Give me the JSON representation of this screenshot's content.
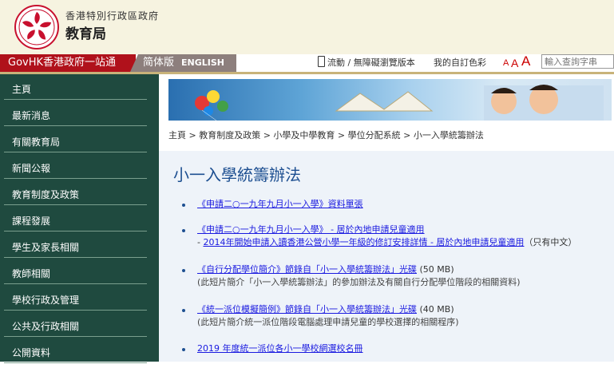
{
  "header": {
    "gov_name": "香港特別行政區政府",
    "bureau_name": "教育局"
  },
  "topbar": {
    "govhk": "GovHK香港政府一站通",
    "lang_tc": "简体版",
    "lang_en": "ENGLISH",
    "mobile": "流動 / 無障礙瀏覽版本",
    "my_pref": "我的自訂色彩",
    "font_sizes": [
      "A",
      "A",
      "A"
    ],
    "search_placeholder": "輸入查詢字串"
  },
  "sidebar": {
    "items": [
      "主頁",
      "最新消息",
      "有關教育局",
      "新聞公報",
      "教育制度及政策",
      "課程發展",
      "學生及家長相關",
      "教師相關",
      "學校行政及管理",
      "公共及行政相關",
      "公開資料"
    ]
  },
  "breadcrumb": "主頁 > 教育制度及政策 > 小學及中學教育 > 學位分配系統 > 小一入學統籌辦法",
  "page_title": "小一入學統籌辦法",
  "items": [
    {
      "link": "《申請二○一九年九月小一入學》資料單張"
    },
    {
      "link": "《申請二○一九年九月小一入學》 - 居於內地申請兒童適用",
      "sub_prefix": "- ",
      "sub_link": "2014年開始申請入讀香港公營小學一年級的修訂安排詳情 - 居於內地申請兒童適用",
      "sub_suffix": "（只有中文）"
    },
    {
      "link": "《自行分配學位簡介》節錄自「小一入學統籌辦法」光碟",
      "size": "(50 MB)",
      "note": "(此短片簡介「小一入學統籌辦法」的參加辦法及有關自行分配學位階段的相關資料)"
    },
    {
      "link": "《統一派位模擬簡例》節錄自「小一入學統籌辦法」光碟",
      "size": "(40 MB)",
      "note": "(此短片簡介統一派位階段電腦處理申請兒童的學校選擇的相關程序)"
    },
    {
      "link": "2019 年度統一派位各小一學校網選校名冊"
    }
  ],
  "colors": {
    "sidebar_bg": "#1f4a3f",
    "govhk_red": "#b0111b",
    "title_blue": "#1d4f91",
    "link_blue": "#1a1ae0"
  },
  "icons": [
    "hksar-emblem-icon",
    "mobile-phone-icon",
    "banner-image"
  ]
}
